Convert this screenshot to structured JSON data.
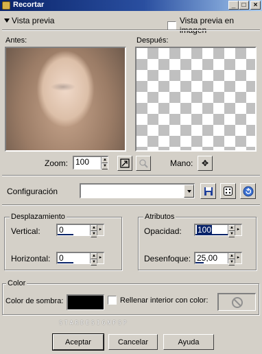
{
  "window": {
    "title": "Recortar",
    "minimize_glyph": "_",
    "maximize_glyph": "□",
    "close_glyph": "×"
  },
  "preview": {
    "toggle_label": "Vista previa",
    "image_preview_label": "Vista previa en imagen",
    "before_label": "Antes:",
    "after_label": "Después:"
  },
  "zoom": {
    "label": "Zoom:",
    "value": "100",
    "pan_label": "Mano:"
  },
  "config": {
    "label": "Configuración",
    "value": ""
  },
  "displacement": {
    "legend": "Desplazamiento",
    "vertical_label": "Vertical:",
    "vertical_value": "0",
    "horizontal_label": "Horizontal:",
    "horizontal_value": "0"
  },
  "attributes": {
    "legend": "Atributos",
    "opacity_label": "Opacidad:",
    "opacity_value": "100",
    "blur_label": "Desenfoque:",
    "blur_value": "25,00"
  },
  "color": {
    "legend": "Color",
    "shadow_label": "Color de sombra:",
    "shadow_color": "#000000",
    "fill_label": "Rellenar interior con color:"
  },
  "watermark": "STARDESIGNPSP",
  "buttons": {
    "ok": "Aceptar",
    "cancel": "Cancelar",
    "help": "Ayuda"
  },
  "icons": {
    "zoom_fit": "fit-window-icon",
    "zoom_disabled": "zoom-magnifier-icon",
    "pan": "move-arrows-icon",
    "save": "save-disk-icon",
    "random": "dice-icon",
    "reset": "reset-arrow-icon",
    "no_color": "no-color-icon"
  }
}
